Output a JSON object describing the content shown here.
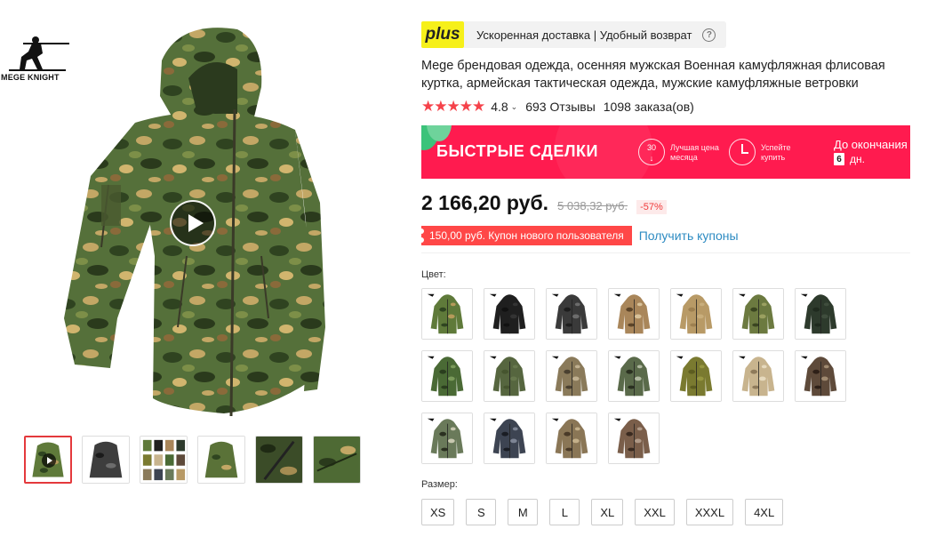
{
  "brand": {
    "logo_text": "MEGE KNIGHT"
  },
  "gallery": {
    "thumbnails": [
      {
        "name": "thumb-green-camo-video",
        "active": true
      },
      {
        "name": "thumb-black-camo"
      },
      {
        "name": "thumb-all-colors"
      },
      {
        "name": "thumb-green-camo"
      },
      {
        "name": "thumb-detail-zip"
      },
      {
        "name": "thumb-detail-fabric"
      }
    ]
  },
  "delivery": {
    "plus_badge": "plus",
    "text": "Ускоренная доставка | Удобный возврат",
    "help_icon": "?"
  },
  "product": {
    "title": "Mege брендовая одежда, осенняя мужская Военная камуфляжная флисовая куртка, армейская тактическая одежда, мужские камуфляжные ветровки",
    "rating": {
      "stars": "★★★★★",
      "value": "4.8",
      "caret": "⌄",
      "reviews": "693 Отзывы",
      "orders": "1098 заказа(ов)"
    },
    "price": "2 166,20 руб.",
    "old_price": "5 038,32 руб.",
    "discount": "-57%"
  },
  "deals": {
    "title": "БЫСТРЫЕ СДЕЛКИ",
    "day_number": "30",
    "day_label": "Лучшая цена месяца",
    "hurry_label": "Успейте купить",
    "ends_label": "До окончания",
    "days_value": "6",
    "days_unit": "дн."
  },
  "coupon": {
    "text": "150,00 руб. Купон нового пользователя",
    "link": "Получить купоны"
  },
  "colors": {
    "label": "Цвет:",
    "swatches": [
      {
        "name": "swatch-multicam-green",
        "base": "#5f7a3a",
        "spots": [
          "#2f4520",
          "#b59a5a"
        ]
      },
      {
        "name": "swatch-black",
        "base": "#1f1f1f",
        "spots": [
          "#111111",
          "#333333"
        ]
      },
      {
        "name": "swatch-black-camo",
        "base": "#3a3a3a",
        "spots": [
          "#1d1d1d",
          "#6c6c6c"
        ]
      },
      {
        "name": "swatch-desert-camo",
        "base": "#a9865a",
        "spots": [
          "#5c4428",
          "#d8c29a"
        ]
      },
      {
        "name": "swatch-khaki",
        "base": "#b89a66",
        "spots": [
          "#9e8050",
          "#c9ae7c"
        ]
      },
      {
        "name": "swatch-woodland-green",
        "base": "#6c7a40",
        "spots": [
          "#3a4520",
          "#9aa060"
        ]
      },
      {
        "name": "swatch-dark-green",
        "base": "#2d3a2c",
        "spots": [
          "#1f2a1e",
          "#3f4d3d"
        ]
      },
      {
        "name": "swatch-green-camo",
        "base": "#4a6a35",
        "spots": [
          "#2a3e1e",
          "#7a9a5a"
        ]
      },
      {
        "name": "swatch-army-green",
        "base": "#56663f",
        "spots": [
          "#46552f",
          "#67784d"
        ]
      },
      {
        "name": "swatch-cp-camo",
        "base": "#8a7a5a",
        "spots": [
          "#4a4030",
          "#c0b090"
        ]
      },
      {
        "name": "swatch-digital-green",
        "base": "#5a6a4a",
        "spots": [
          "#2a3020",
          "#b0b8a0"
        ]
      },
      {
        "name": "swatch-olive",
        "base": "#7a7a30",
        "spots": [
          "#5d5d20",
          "#969640"
        ]
      },
      {
        "name": "swatch-sand-camo",
        "base": "#c8b48e",
        "spots": [
          "#8e7a5a",
          "#e6d9bd"
        ]
      },
      {
        "name": "swatch-brown-camo",
        "base": "#5e4a3a",
        "spots": [
          "#2e2018",
          "#a08a70"
        ]
      },
      {
        "name": "swatch-python-green",
        "base": "#6a7a5a",
        "spots": [
          "#2a3020",
          "#c8c8b0"
        ]
      },
      {
        "name": "swatch-urban-black",
        "base": "#3d4452",
        "spots": [
          "#1a1d24",
          "#7d8494"
        ]
      },
      {
        "name": "swatch-tan-camo",
        "base": "#8a7656",
        "spots": [
          "#4a3a28",
          "#c4b08a"
        ]
      },
      {
        "name": "swatch-brown-digital",
        "base": "#7a5e4a",
        "spots": [
          "#3a2a20",
          "#b09a88"
        ]
      }
    ]
  },
  "sizes": {
    "label": "Размер:",
    "options": [
      "XS",
      "S",
      "M",
      "L",
      "XL",
      "XXL",
      "XXXL",
      "4XL"
    ]
  }
}
